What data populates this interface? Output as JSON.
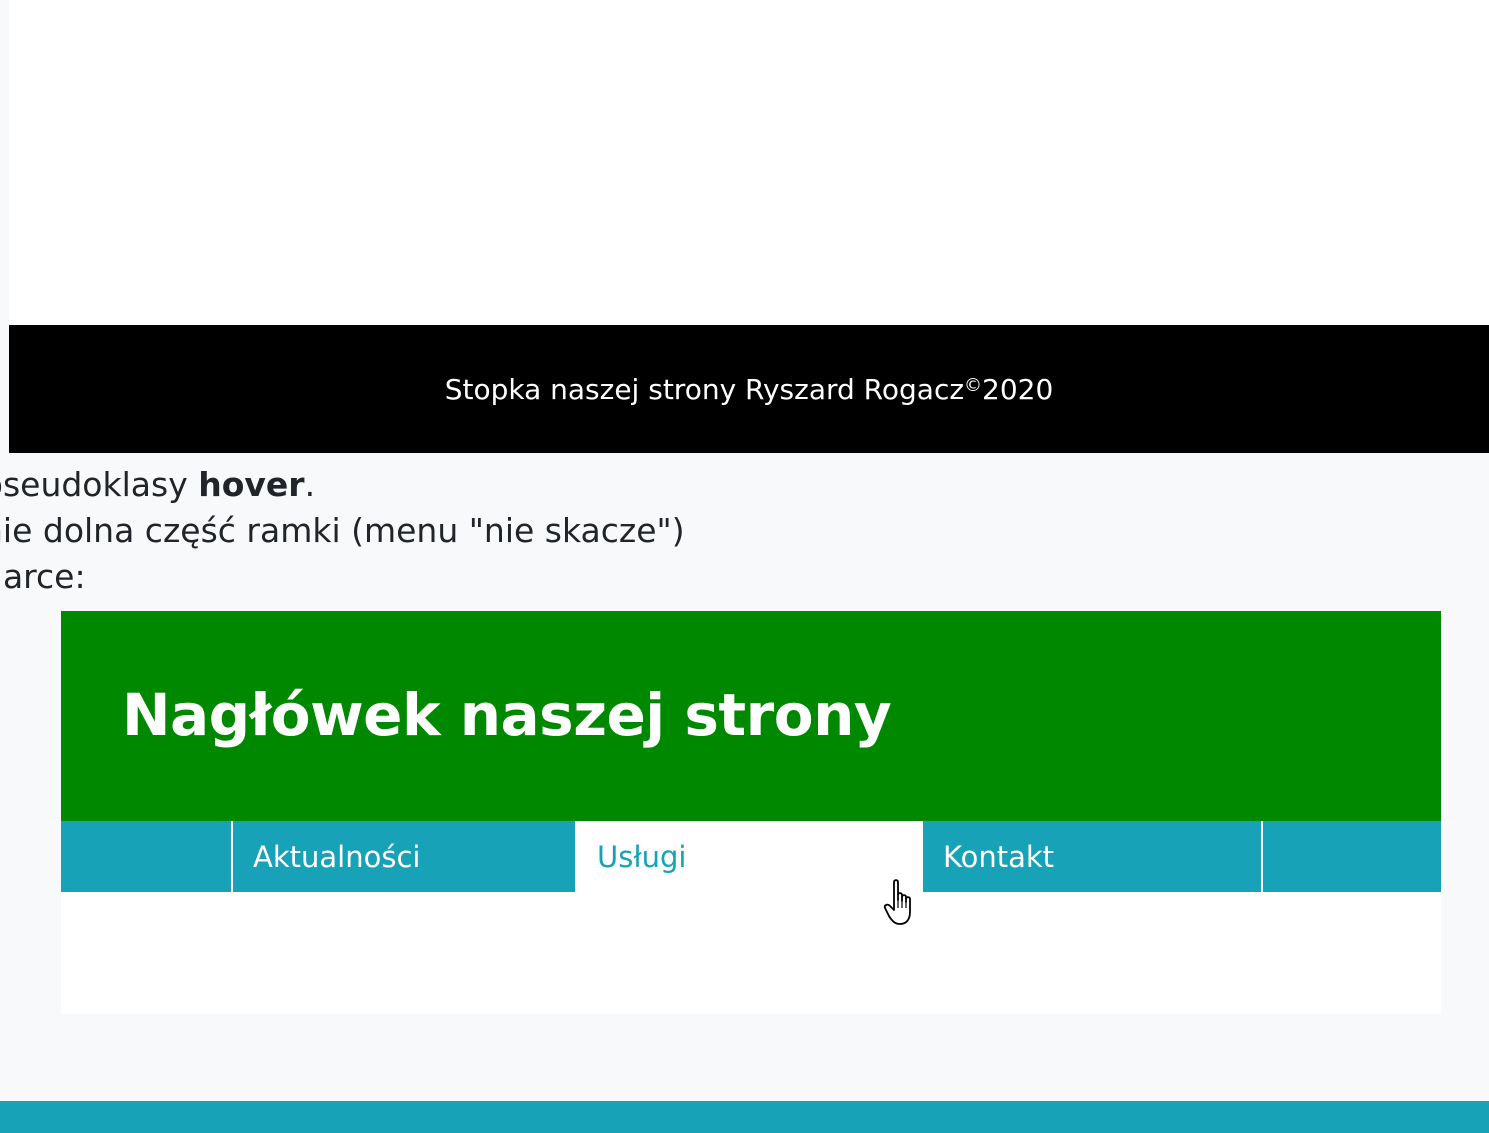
{
  "top_example": {
    "footer_text": "Stopka naszej strony Ryszard Rogacz",
    "footer_copyright": "©",
    "footer_year": " 2020"
  },
  "paragraph": {
    "line1_prefix": "pseudoklasy ",
    "line1_bold": "hover",
    "line1_suffix": ".",
    "line2": "nie dolna część ramki (menu \"nie skacze\")",
    "line3": "darce:"
  },
  "demo": {
    "header_title": "Nagłówek naszej strony",
    "nav": [
      {
        "label": "Aktualności",
        "active": false
      },
      {
        "label": "Usługi",
        "active": true
      },
      {
        "label": "Kontakt",
        "active": false
      }
    ]
  },
  "colors": {
    "header_green": "#008800",
    "nav_teal": "#17a2b8",
    "footer_black": "#000000"
  },
  "icons": {
    "cursor": "hand-pointer-icon"
  }
}
